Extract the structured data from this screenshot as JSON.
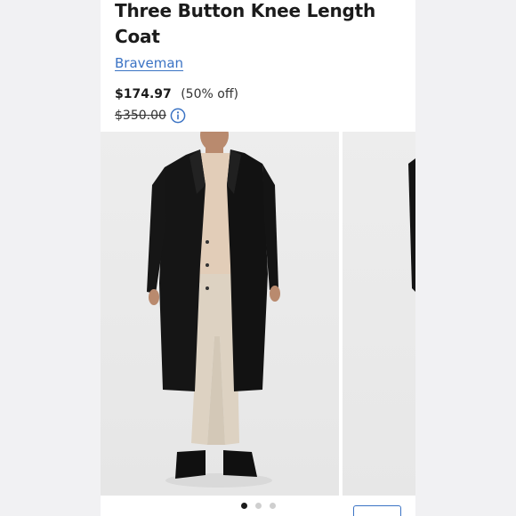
{
  "product": {
    "title": "Three Button Knee Length Coat",
    "brand": "Braveman",
    "price": "$174.97",
    "discount": "(50% off)",
    "original_price": "$350.00"
  },
  "icons": {
    "info": "info-circle-icon"
  },
  "carousel": {
    "count": 3,
    "active": 1
  },
  "colors": {
    "link": "#3b73c4",
    "text": "#1b1b1b",
    "background": "#f1f1f3"
  }
}
